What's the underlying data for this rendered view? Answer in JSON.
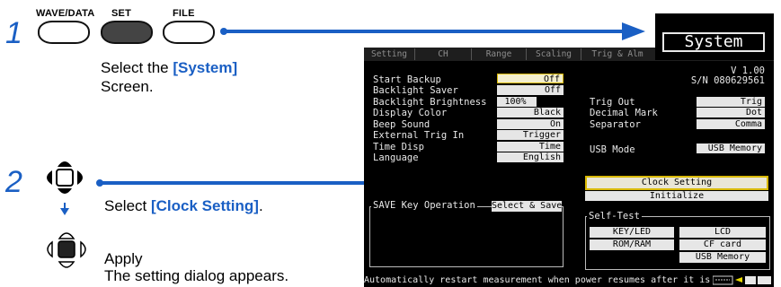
{
  "colors": {
    "accent": "#1a5fc4",
    "screen_bg": "#000000",
    "highlight": "#d8b800"
  },
  "step1": {
    "number": "1",
    "keys": [
      {
        "label": "WAVE/DATA",
        "state": "normal"
      },
      {
        "label": "SET",
        "state": "pressed"
      },
      {
        "label": "FILE",
        "state": "normal"
      }
    ],
    "text_pre": "Select the ",
    "text_hl": "[System]",
    "text_post": "Screen."
  },
  "step2": {
    "number": "2",
    "select_pre": "Select ",
    "select_hl": "[Clock Setting]",
    "select_post": ".",
    "apply_label": "Apply",
    "apply_desc": "The setting dialog appears."
  },
  "screen": {
    "title": "System",
    "tabs": [
      "Setting",
      "CH",
      "Range",
      "Scaling",
      "Trig & Alm"
    ],
    "version": "V 1.00",
    "serial": "S/N 080629561",
    "left_settings": [
      {
        "label": "Start Backup",
        "value": "Off"
      },
      {
        "label": "Backlight Saver",
        "value": "Off"
      },
      {
        "label": "Backlight Brightness",
        "value": "100%"
      },
      {
        "label": "Display Color",
        "value": "Black"
      },
      {
        "label": "Beep Sound",
        "value": "On"
      },
      {
        "label": "External Trig In",
        "value": "Trigger"
      },
      {
        "label": "Time Disp",
        "value": "Time"
      },
      {
        "label": "Language",
        "value": "English"
      }
    ],
    "right_settings": [
      {
        "label": "Trig Out",
        "value": "Trig"
      },
      {
        "label": "Decimal Mark",
        "value": "Dot"
      },
      {
        "label": "Separator",
        "value": "Comma"
      }
    ],
    "usb_mode": {
      "label": "USB Mode",
      "value": "USB Memory"
    },
    "clock_setting": "Clock Setting",
    "initialize": "Initialize",
    "save_key": {
      "label": "SAVE Key Operation",
      "value": "Select & Save"
    },
    "self_test": {
      "title": "Self-Test",
      "buttons": [
        "KEY/LED",
        "LCD",
        "ROM/RAM",
        "CF card",
        "USB Memory"
      ]
    },
    "status_text": "Automatically restart measurement when power resumes after it is",
    "status_icons": [
      "status-indicator",
      "cf-card",
      "usb"
    ]
  }
}
